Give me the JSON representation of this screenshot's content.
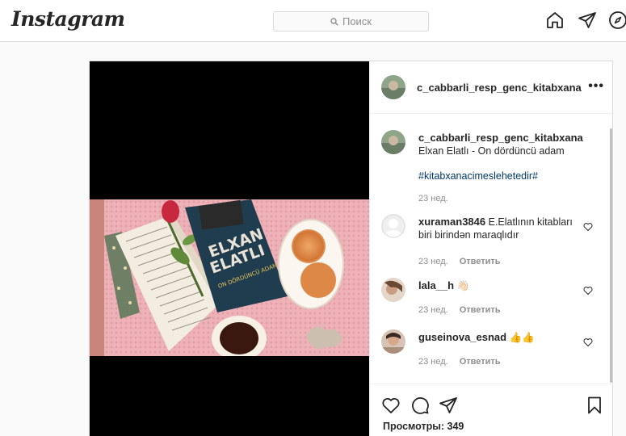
{
  "header": {
    "logo_text": "Instagram",
    "search_placeholder": "Поиск",
    "icons": [
      "home-icon",
      "direct-icon",
      "explore-icon"
    ]
  },
  "post": {
    "author": "c_cabbarli_resp_genc_kitabxana",
    "more_label": "•••",
    "caption": {
      "username": "c_cabbarli_resp_genc_kitabxana",
      "text": "Elxan Elatlı - On dördüncü adam",
      "hashtag": "#kitabxanacimeslehetedir#",
      "time": "23 нед."
    },
    "comments": [
      {
        "username": "xuraman3846",
        "text": "E.Elatlının kitabları biri birindən maraqlıdır",
        "time": "23 нед.",
        "reply": "Ответить"
      },
      {
        "username": "lala__h",
        "text": "👋🏻",
        "time": "23 нед.",
        "reply": "Ответить"
      },
      {
        "username": "guseinova_esnad",
        "text": "👍👍",
        "time": "23 нед.",
        "reply": "Ответить"
      }
    ],
    "views_label": "Просмотры: 349",
    "book": {
      "author_line1": "ELXAN",
      "author_line2": "ELATLI",
      "title": "ON DÖRDÜNCÜ ADAM"
    }
  },
  "colors": {
    "link": "#00376b",
    "muted": "#8e8e8e",
    "border": "#dbdbdb"
  }
}
